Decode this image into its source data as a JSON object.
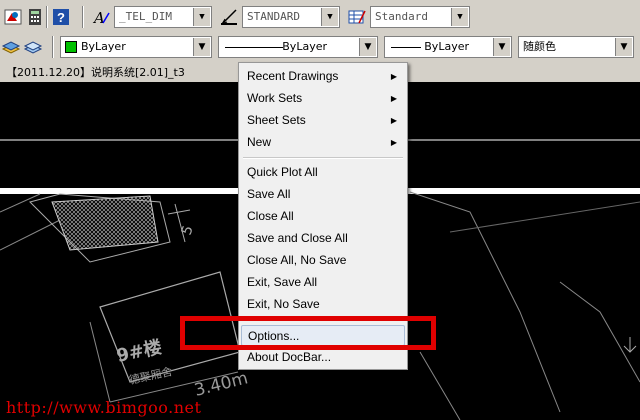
{
  "toolbar": {
    "text_style": "_TEL_DIM",
    "dim_style": "STANDARD",
    "table_style": "Standard",
    "layer": "ByLayer",
    "linetype": "ByLayer",
    "lineweight": "ByLayer",
    "color": "随颜色"
  },
  "doc_tab": {
    "label": "【2011.12.20】说明系统[2.01]_t3"
  },
  "menu": {
    "items": [
      {
        "label": "Recent Drawings"
      },
      {
        "label": "Work Sets"
      },
      {
        "label": "Sheet Sets"
      },
      {
        "label": "New"
      },
      {
        "label": "Quick Plot All"
      },
      {
        "label": "Save All"
      },
      {
        "label": "Close All"
      },
      {
        "label": "Save and Close All"
      },
      {
        "label": "Close All, No Save"
      },
      {
        "label": "Exit, Save All"
      },
      {
        "label": "Exit, No Save"
      },
      {
        "label": "Options..."
      },
      {
        "label": "About DocBar..."
      }
    ]
  },
  "drawing": {
    "building_label": "9#楼",
    "sub_label": "德聚厢舍",
    "elevation": "3.40m",
    "dim_text": "5"
  },
  "watermark": "http://www.bimgoo.net",
  "colors": {
    "highlight": "#e00000",
    "layer_swatch": "#00c000"
  }
}
